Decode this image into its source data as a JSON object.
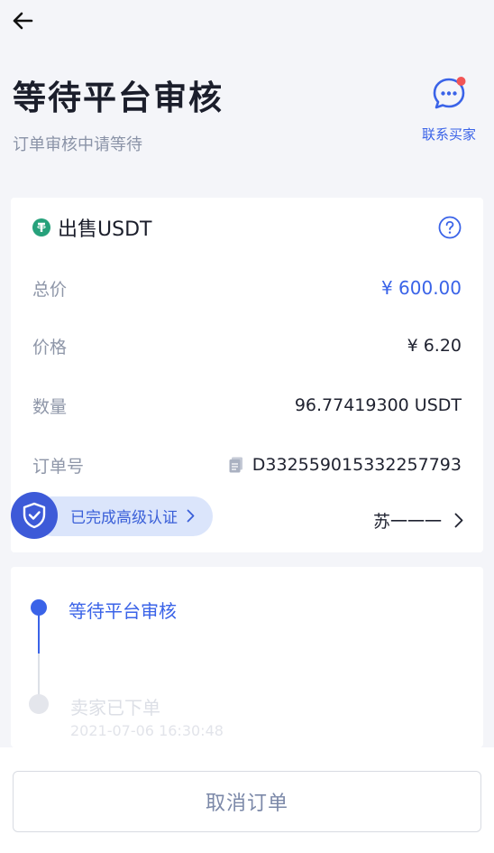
{
  "header": {
    "title": "等待平台审核",
    "subtitle": "订单审核中请等待",
    "contact_label": "联系买家"
  },
  "order": {
    "title": "出售USDT",
    "rows": [
      {
        "label": "总价",
        "value": "¥ 600.00"
      },
      {
        "label": "价格",
        "value": "¥ 6.20"
      },
      {
        "label": "数量",
        "value": "96.77419300 USDT"
      },
      {
        "label": "订单号",
        "value": "D332559015332257793"
      }
    ],
    "verify_label": "已完成高级认证",
    "seller_name": "苏一一一"
  },
  "timeline": {
    "steps": [
      {
        "label": "等待平台审核",
        "time": ""
      },
      {
        "label": "卖家已下单",
        "time": "2021-07-06 16:30:48"
      }
    ]
  },
  "actions": {
    "cancel_label": "取消订单"
  },
  "colors": {
    "accent": "#3a63e8",
    "tether": "#26a17b",
    "badge": "#f25555",
    "shield": "#3d5ad8"
  },
  "icons": {
    "back": "arrow-left-icon",
    "contact": "chat-bubble-icon",
    "coin": "tether-icon",
    "help": "question-circle-icon",
    "copy": "copy-icon",
    "verify": "shield-check-icon"
  }
}
